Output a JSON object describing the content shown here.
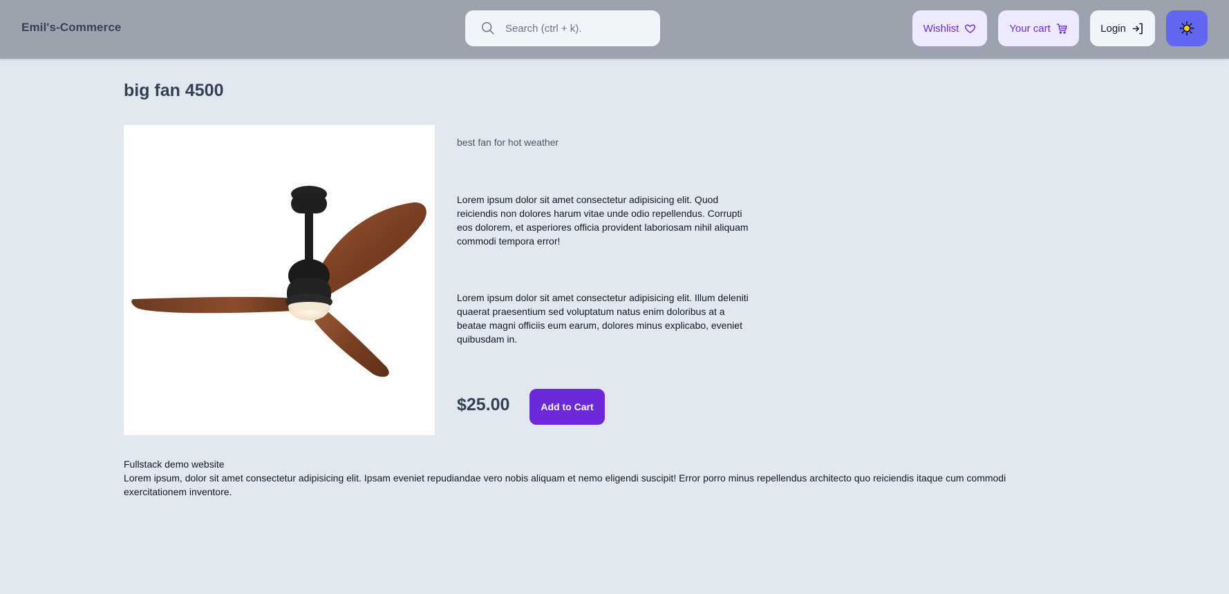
{
  "header": {
    "brand": "Emil's-Commerce",
    "search": {
      "placeholder": "Search (ctrl + k).",
      "icon": "search-icon"
    },
    "wishlist_label": "Wishlist",
    "cart_label": "Your cart",
    "login_label": "Login",
    "theme_icon": "sun-icon"
  },
  "product": {
    "title": "big fan 4500",
    "image_alt": "ceiling fan",
    "subtitle": "best fan for hot weather",
    "description": [
      "Lorem ipsum dolor sit amet consectetur adipisicing elit. Quod reiciendis non dolores harum vitae unde odio repellendus. Corrupti eos dolorem, et asperiores officia provident laboriosam nihil aliquam commodi tempora error!",
      "Lorem ipsum dolor sit amet consectetur adipisicing elit. Illum deleniti quaerat praesentium sed voluptatum natus enim doloribus at a beatae magni officiis eum earum, dolores minus explicabo, eveniet quibusdam in."
    ],
    "price": "$25.00",
    "add_to_cart_label": "Add to Cart"
  },
  "footer": {
    "title": "Fullstack demo website",
    "text": "Lorem ipsum, dolor sit amet consectetur adipisicing elit. Ipsam eveniet repudiandae vero nobis aliquam et nemo eligendi suscipit! Error porro minus repellendus architecto quo reiciendis itaque cum commodi exercitationem inventore."
  },
  "colors": {
    "accent": "#6d28d9",
    "header_bg": "#9ca3af",
    "page_bg": "#e2e8f0",
    "theme_button": "#6366f1"
  }
}
